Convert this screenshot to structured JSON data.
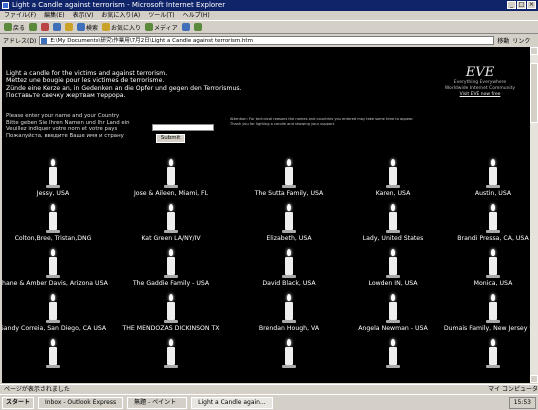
{
  "window": {
    "title": "Light a Candle against terrorism - Microsoft Internet Explorer",
    "menu": [
      "ファイル(F)",
      "編集(E)",
      "表示(V)",
      "お気に入り(A)",
      "ツール(T)",
      "ヘルプ(H)"
    ]
  },
  "toolbar": {
    "back": "戻る",
    "search": "検索",
    "favorites": "お気に入り",
    "media": "メディア"
  },
  "address": {
    "label": "アドレス(D)",
    "value": "E:\\My Documents\\研究\\作業用\\7月2日\\Light a Candle against terrorism.htm",
    "go": "移動",
    "links": "リンク"
  },
  "page": {
    "intro": [
      "Light a candle for the victims and against terrorism.",
      "Mettez une bougie pour les victimes de terrorisme.",
      "Zünde eine Kerze an, in Gedenken an die Opfer und gegen den Terrorismus.",
      "Поставьте свечку жертвам террора."
    ],
    "brand": {
      "logo": "EVE",
      "subtitle_1": "Everything Everywhere",
      "subtitle_2": "Worldwide Internet Community",
      "link": "Visit EVE now free"
    },
    "prompt": [
      "Please enter your name and your Country",
      "Bitte geben Sie Ihren Namen und Ihr Land ein",
      "Veuillez indiquer votre nom et votre pays",
      "Пожалуйста, введите Ваше имя и страну"
    ],
    "submit": "Submit",
    "notice": [
      "Attention: For technical reasons the names and countries you entered may take some time to appear.",
      "Thank you for lighting a candle and showing your support."
    ]
  },
  "candles": [
    {
      "name": "Jessy, USA"
    },
    {
      "name": "Jose & Aileen, Miami, FL"
    },
    {
      "name": "The Sutta Family, USA"
    },
    {
      "name": "Karen, USA"
    },
    {
      "name": "Austin, USA"
    },
    {
      "name": "Colton,Bree, Tristan,DNG"
    },
    {
      "name": "Kat Green LA/NY/IV"
    },
    {
      "name": "Elizabeth, USA"
    },
    {
      "name": "Lady, United States"
    },
    {
      "name": "Brandi Pressa, CA, USA"
    },
    {
      "name": "Shane & Amber Davis, Arizona USA"
    },
    {
      "name": "The Gaddie Family - USA"
    },
    {
      "name": "David Black, USA"
    },
    {
      "name": "Lowden IN, USA"
    },
    {
      "name": "Monica, USA"
    },
    {
      "name": "Sandy Correia, San Diego, CA USA"
    },
    {
      "name": "THE MENDOZAS DICKINSON TX"
    },
    {
      "name": "Brendan Hough, VA"
    },
    {
      "name": "Angela Newman - USA"
    },
    {
      "name": "Dumais Family, New Jersey USA"
    },
    {
      "name": ""
    },
    {
      "name": ""
    },
    {
      "name": ""
    },
    {
      "name": ""
    },
    {
      "name": ""
    }
  ],
  "statusbar": {
    "left": "ページが表示されました",
    "right": "マイ コンピュータ"
  },
  "taskbar": {
    "start": "スタート",
    "tasks": [
      "Inbox - Outlook Express",
      "無題 - ペイント",
      "Light a Candle again..."
    ],
    "clock": "15:53"
  }
}
